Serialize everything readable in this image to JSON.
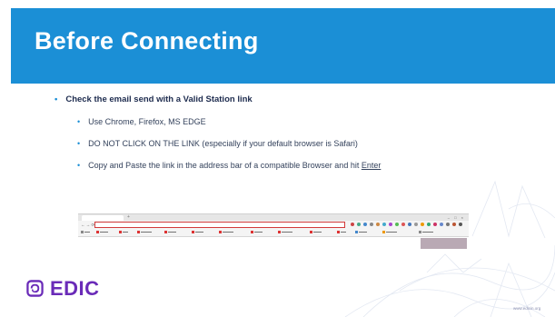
{
  "slide": {
    "title": "Before Connecting",
    "bullet_main": "Check the email send with a Valid Station link",
    "sub_bullets": [
      "Use Chrome, Firefox, MS EDGE",
      "DO NOT CLICK ON THE LINK (especially if your default browser is Safari)",
      "Copy and Paste the link in the address bar of a compatible Browser and hit "
    ],
    "enter_word": "Enter",
    "brand": "EDIC",
    "footer_url": "www.edicin.org",
    "colors": {
      "header": "#1b8fd6",
      "brand": "#6a2bb8",
      "address_highlight": "#d23a3a"
    }
  }
}
